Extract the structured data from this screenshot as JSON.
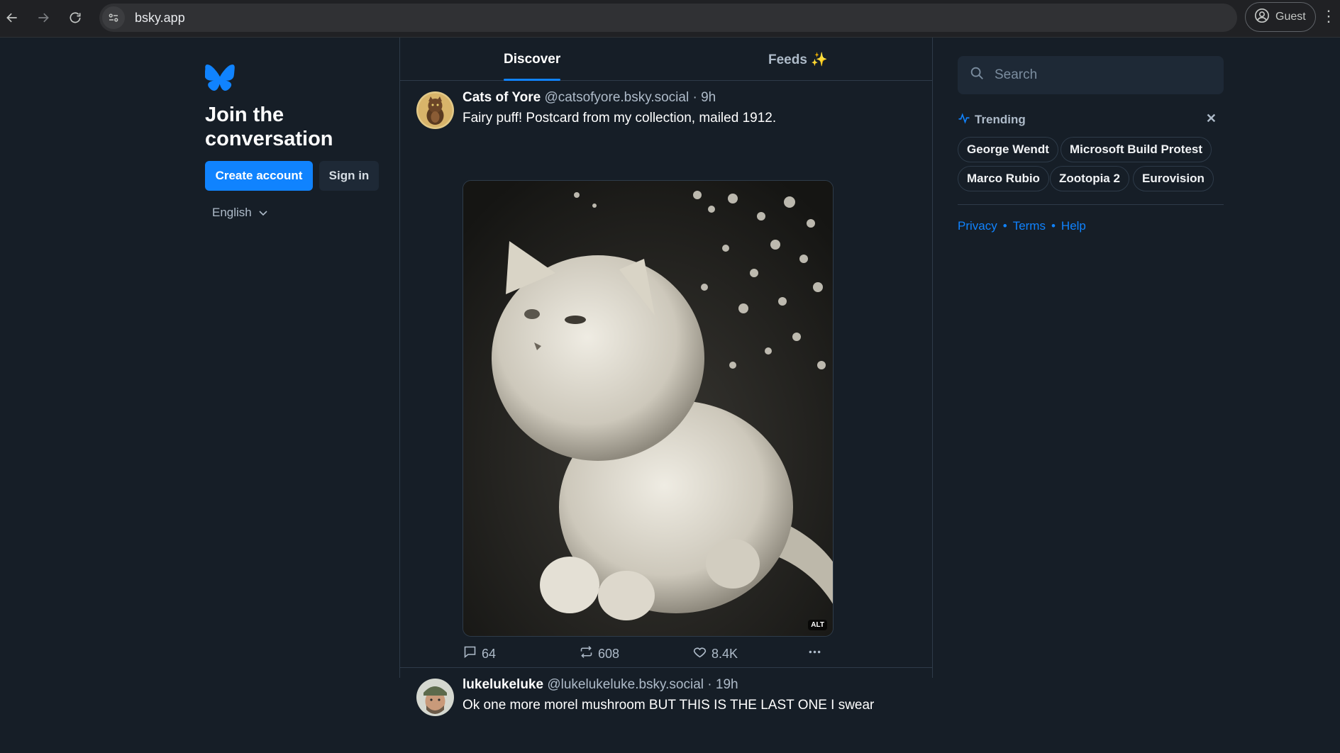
{
  "browser": {
    "url": "bsky.app",
    "profile_label": "Guest"
  },
  "left": {
    "join_title": "Join the conversation",
    "create_account": "Create account",
    "sign_in": "Sign in",
    "language": "English"
  },
  "tabs": [
    {
      "label": "Discover",
      "active": true
    },
    {
      "label": "Feeds ✨",
      "active": false
    }
  ],
  "posts": [
    {
      "author": "Cats of Yore",
      "handle": "@catsofyore.bsky.social · 9h",
      "text": "Fairy puff! Postcard from my collection, mailed 1912.",
      "alt_badge": "ALT",
      "replies": "64",
      "reposts": "608",
      "likes": "8.4K"
    },
    {
      "author": "lukelukeluke",
      "handle": "@lukelukeluke.bsky.social · 19h",
      "text": "Ok one more morel mushroom BUT THIS IS THE LAST ONE I swear"
    }
  ],
  "right": {
    "search_placeholder": "Search",
    "trending_label": "Trending",
    "trending": [
      "George Wendt",
      "Microsoft Build Protest",
      "Marco Rubio",
      "Zootopia 2",
      "Eurovision"
    ],
    "footer": [
      "Privacy",
      "Terms",
      "Help"
    ]
  },
  "colors": {
    "background": "#161e27",
    "accent": "#1083fe",
    "border": "#2e3b49",
    "muted_text": "#aebbc9"
  }
}
